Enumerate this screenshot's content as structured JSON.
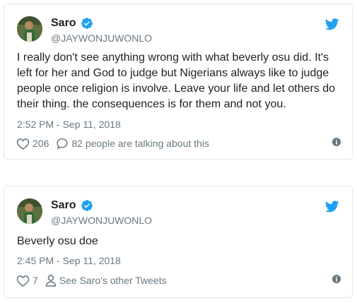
{
  "colors": {
    "twitter_blue": "#1da1f2",
    "text": "#1c2022",
    "muted": "#697882",
    "border": "#e1e8ed"
  },
  "tweets": [
    {
      "author": {
        "name": "Saro",
        "handle": "@JAYWONJUWONLO",
        "verified": true
      },
      "text": "I really don't see anything wrong with what beverly osu did. It's left for her and God to judge but Nigerians always like to judge people once religion is involve.  Leave your life and let others do their thing. the consequences is for them and not you.",
      "timestamp": "2:52 PM - Sep 11, 2018",
      "likes": "206",
      "secondary_action": "82 people are talking about this",
      "secondary_icon": "reply-bubble-icon"
    },
    {
      "author": {
        "name": "Saro",
        "handle": "@JAYWONJUWONLO",
        "verified": true
      },
      "text": "Beverly osu doe",
      "timestamp": "2:45 PM - Sep 11, 2018",
      "likes": "7",
      "secondary_action": "See Saro's other Tweets",
      "secondary_icon": "person-icon"
    }
  ],
  "icons": {
    "verified": "verified-badge-icon",
    "bird": "twitter-bird-icon",
    "like": "heart-icon",
    "info": "info-icon"
  }
}
